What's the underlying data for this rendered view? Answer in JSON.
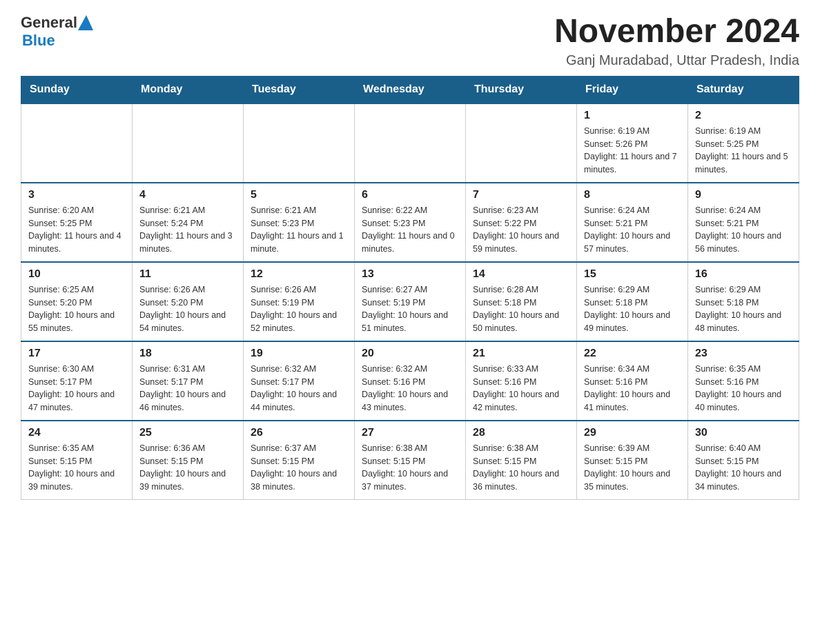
{
  "logo": {
    "general": "General",
    "blue": "Blue"
  },
  "title": "November 2024",
  "location": "Ganj Muradabad, Uttar Pradesh, India",
  "weekdays": [
    "Sunday",
    "Monday",
    "Tuesday",
    "Wednesday",
    "Thursday",
    "Friday",
    "Saturday"
  ],
  "weeks": [
    [
      {
        "day": "",
        "info": ""
      },
      {
        "day": "",
        "info": ""
      },
      {
        "day": "",
        "info": ""
      },
      {
        "day": "",
        "info": ""
      },
      {
        "day": "",
        "info": ""
      },
      {
        "day": "1",
        "info": "Sunrise: 6:19 AM\nSunset: 5:26 PM\nDaylight: 11 hours and 7 minutes."
      },
      {
        "day": "2",
        "info": "Sunrise: 6:19 AM\nSunset: 5:25 PM\nDaylight: 11 hours and 5 minutes."
      }
    ],
    [
      {
        "day": "3",
        "info": "Sunrise: 6:20 AM\nSunset: 5:25 PM\nDaylight: 11 hours and 4 minutes."
      },
      {
        "day": "4",
        "info": "Sunrise: 6:21 AM\nSunset: 5:24 PM\nDaylight: 11 hours and 3 minutes."
      },
      {
        "day": "5",
        "info": "Sunrise: 6:21 AM\nSunset: 5:23 PM\nDaylight: 11 hours and 1 minute."
      },
      {
        "day": "6",
        "info": "Sunrise: 6:22 AM\nSunset: 5:23 PM\nDaylight: 11 hours and 0 minutes."
      },
      {
        "day": "7",
        "info": "Sunrise: 6:23 AM\nSunset: 5:22 PM\nDaylight: 10 hours and 59 minutes."
      },
      {
        "day": "8",
        "info": "Sunrise: 6:24 AM\nSunset: 5:21 PM\nDaylight: 10 hours and 57 minutes."
      },
      {
        "day": "9",
        "info": "Sunrise: 6:24 AM\nSunset: 5:21 PM\nDaylight: 10 hours and 56 minutes."
      }
    ],
    [
      {
        "day": "10",
        "info": "Sunrise: 6:25 AM\nSunset: 5:20 PM\nDaylight: 10 hours and 55 minutes."
      },
      {
        "day": "11",
        "info": "Sunrise: 6:26 AM\nSunset: 5:20 PM\nDaylight: 10 hours and 54 minutes."
      },
      {
        "day": "12",
        "info": "Sunrise: 6:26 AM\nSunset: 5:19 PM\nDaylight: 10 hours and 52 minutes."
      },
      {
        "day": "13",
        "info": "Sunrise: 6:27 AM\nSunset: 5:19 PM\nDaylight: 10 hours and 51 minutes."
      },
      {
        "day": "14",
        "info": "Sunrise: 6:28 AM\nSunset: 5:18 PM\nDaylight: 10 hours and 50 minutes."
      },
      {
        "day": "15",
        "info": "Sunrise: 6:29 AM\nSunset: 5:18 PM\nDaylight: 10 hours and 49 minutes."
      },
      {
        "day": "16",
        "info": "Sunrise: 6:29 AM\nSunset: 5:18 PM\nDaylight: 10 hours and 48 minutes."
      }
    ],
    [
      {
        "day": "17",
        "info": "Sunrise: 6:30 AM\nSunset: 5:17 PM\nDaylight: 10 hours and 47 minutes."
      },
      {
        "day": "18",
        "info": "Sunrise: 6:31 AM\nSunset: 5:17 PM\nDaylight: 10 hours and 46 minutes."
      },
      {
        "day": "19",
        "info": "Sunrise: 6:32 AM\nSunset: 5:17 PM\nDaylight: 10 hours and 44 minutes."
      },
      {
        "day": "20",
        "info": "Sunrise: 6:32 AM\nSunset: 5:16 PM\nDaylight: 10 hours and 43 minutes."
      },
      {
        "day": "21",
        "info": "Sunrise: 6:33 AM\nSunset: 5:16 PM\nDaylight: 10 hours and 42 minutes."
      },
      {
        "day": "22",
        "info": "Sunrise: 6:34 AM\nSunset: 5:16 PM\nDaylight: 10 hours and 41 minutes."
      },
      {
        "day": "23",
        "info": "Sunrise: 6:35 AM\nSunset: 5:16 PM\nDaylight: 10 hours and 40 minutes."
      }
    ],
    [
      {
        "day": "24",
        "info": "Sunrise: 6:35 AM\nSunset: 5:15 PM\nDaylight: 10 hours and 39 minutes."
      },
      {
        "day": "25",
        "info": "Sunrise: 6:36 AM\nSunset: 5:15 PM\nDaylight: 10 hours and 39 minutes."
      },
      {
        "day": "26",
        "info": "Sunrise: 6:37 AM\nSunset: 5:15 PM\nDaylight: 10 hours and 38 minutes."
      },
      {
        "day": "27",
        "info": "Sunrise: 6:38 AM\nSunset: 5:15 PM\nDaylight: 10 hours and 37 minutes."
      },
      {
        "day": "28",
        "info": "Sunrise: 6:38 AM\nSunset: 5:15 PM\nDaylight: 10 hours and 36 minutes."
      },
      {
        "day": "29",
        "info": "Sunrise: 6:39 AM\nSunset: 5:15 PM\nDaylight: 10 hours and 35 minutes."
      },
      {
        "day": "30",
        "info": "Sunrise: 6:40 AM\nSunset: 5:15 PM\nDaylight: 10 hours and 34 minutes."
      }
    ]
  ]
}
